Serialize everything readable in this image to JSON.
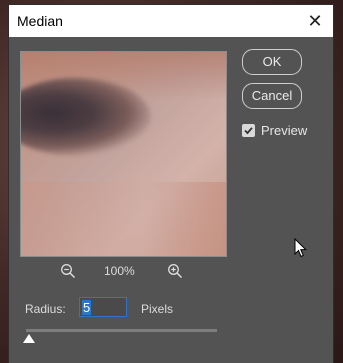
{
  "dialog": {
    "title": "Median",
    "close_glyph": "✕"
  },
  "zoom": {
    "level": "100%",
    "zoom_out_icon": "zoom-out-icon",
    "zoom_in_icon": "zoom-in-icon"
  },
  "buttons": {
    "ok_label": "OK",
    "cancel_label": "Cancel"
  },
  "preview_toggle": {
    "label": "Preview",
    "checked": true
  },
  "radius": {
    "label": "Radius:",
    "value": "5",
    "unit": "Pixels",
    "slider_level": 0.0
  },
  "colors": {
    "dialog_bg": "#535353",
    "focus_blue": "#2e74c9"
  }
}
